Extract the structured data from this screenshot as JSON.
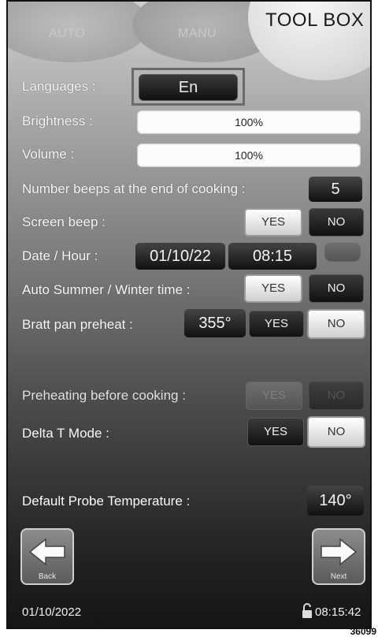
{
  "tabs": {
    "auto": "AUTO",
    "manu": "MANU",
    "toolbox": "TOOL BOX"
  },
  "settings": {
    "languages": {
      "label": "Languages :",
      "value": "En"
    },
    "brightness": {
      "label": "Brightness :",
      "value": "100%"
    },
    "volume": {
      "label": "Volume :",
      "value": "100%"
    },
    "beeps": {
      "label": "Number beeps at the end of cooking :",
      "value": "5"
    },
    "screen_beep": {
      "label": "Screen beep :",
      "yes": "YES",
      "no": "NO"
    },
    "date_hour": {
      "label": "Date / Hour :",
      "date": "01/10/22",
      "time": "08:15"
    },
    "summer_winter": {
      "label": "Auto Summer / Winter time :",
      "yes": "YES",
      "no": "NO"
    },
    "bratt_pan": {
      "label": "Bratt pan preheat :",
      "temp": "355°",
      "yes": "YES",
      "no": "NO"
    },
    "preheating": {
      "label": "Preheating before cooking :",
      "yes": "YES",
      "no": "NO"
    },
    "delta_t": {
      "label": "Delta T Mode :",
      "yes": "YES",
      "no": "NO"
    },
    "probe": {
      "label": "Default Probe Temperature :",
      "value": "140°"
    }
  },
  "nav": {
    "back": "Back",
    "next": "Next"
  },
  "footer": {
    "date": "01/10/2022",
    "time": "08:15:42"
  },
  "figure_ref": "36099",
  "icons": {
    "back": "arrow-left-icon",
    "next": "arrow-right-icon",
    "lock": "lock-icon"
  }
}
